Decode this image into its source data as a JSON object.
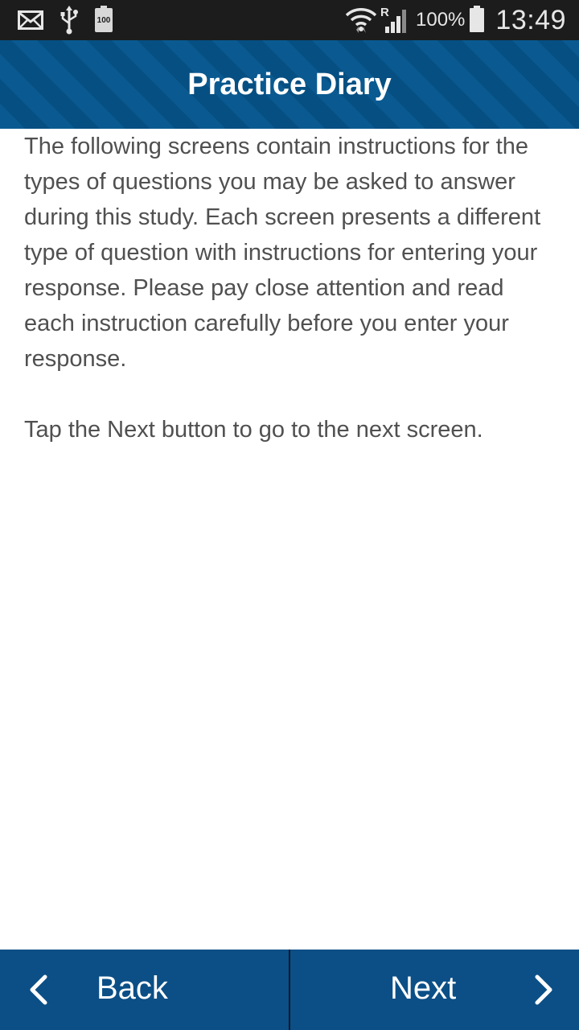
{
  "status_bar": {
    "icons_left": [
      "mail-icon",
      "usb-icon",
      "battery-full-icon"
    ],
    "battery_small_label": "100",
    "icons_right": [
      "wifi-icon",
      "signal-roaming-icon",
      "battery-icon"
    ],
    "roaming_label": "R",
    "battery_percent": "100%",
    "time": "13:49"
  },
  "header": {
    "title": "Practice Diary",
    "color": "#0a5a91"
  },
  "content": {
    "paragraph1": "The following screens contain instructions for the types of questions you may be asked to answer during this study. Each screen presents a different type of question with instructions for entering your response. Please pay close attention and read each instruction carefully before you enter your response.",
    "paragraph2": "Tap the Next button to go to the next screen."
  },
  "bottom_nav": {
    "back_label": "Back",
    "next_label": "Next",
    "back_icon": "chevron-left-icon",
    "next_icon": "chevron-right-icon",
    "color": "#0b4f86"
  }
}
